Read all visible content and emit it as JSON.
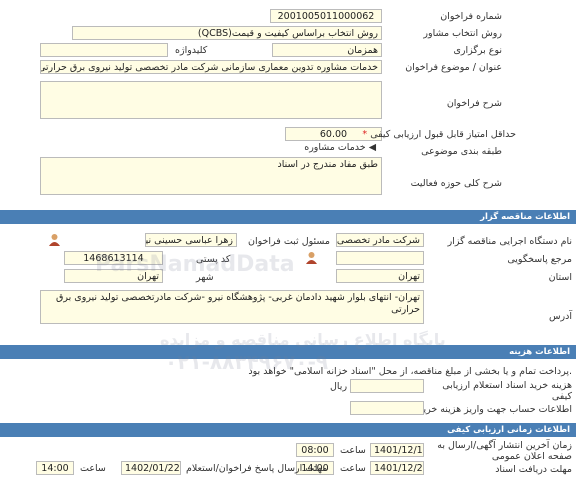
{
  "header": {
    "tender_number_label": "شماره فراخوان",
    "tender_number": "2001005011000062",
    "method_label": "روش انتخاب مشاور",
    "method": "روش انتخاب براساس کیفیت و قیمت(QCBS)",
    "type_label": "نوع برگزاری",
    "type": "همزمان",
    "keyword_label": "کلیدواژه",
    "keyword": "",
    "title_label": "عنوان / موضوع فراخوان",
    "title": "خدمات مشاوره تدوین معماری سازمانی  شرکت مادر تخصصی تولید نیروی برق حرارتی",
    "desc_label": "شرح فراخوان",
    "desc": "",
    "min_score_label": "حداقل امتیاز قابل قبول ارزیابی کیفی",
    "min_score": "60.00",
    "category_label": "طبقه بندی موضوعی",
    "category": "خدمات مشاوره",
    "scope_label": "شرح کلی حوزه فعالیت",
    "scope": "طبق مفاد مندرج در اسناد"
  },
  "organizer_section": {
    "title": "اطلاعات مناقصه گزار",
    "org_name_label": "نام دستگاه اجرایی مناقصه گزار",
    "org_name": "شرکت مادر تخصصی تولید نیروی برق",
    "registrar_label": "مسئول ثبت فراخوان",
    "registrar": "زهرا عباسی حسینی نیارکی",
    "reference_label": "مرجع پاسخگویی",
    "reference": "",
    "postal_label": "کد پستی",
    "postal": "1468613114",
    "province_label": "استان",
    "province": "تهران",
    "city_label": "شهر",
    "city": "تهران",
    "address_label": "آدرس",
    "address": "تهران- انتهای بلوار شهید دادمان غربی- پژوهشگاه نیرو -شرکت مادرتخصصی تولید نیروی برق حرارتی"
  },
  "fee_section": {
    "title": "اطلاعات هزینه",
    "note": "پرداخت تمام و یا بخشی از مبلغ مناقصه، از محل \"اسناد خزانه اسلامی\" خواهد بود.",
    "fee_label": "هزینه خرید اسناد استعلام ارزیابی کیفی",
    "fee": "",
    "currency": "ریال",
    "account_label": "اطلاعات حساب جهت واریز هزینه خرید",
    "account": ""
  },
  "dates_section": {
    "title": "اطلاعات زمانی ارزیابی کیفی",
    "publish_label": "زمان آخرین انتشار آگهی/ارسال به صفحه اعلان عمومی",
    "publish_date": "1401/12/16",
    "publish_time": "08:00",
    "time_label": "ساعت",
    "download_label": "مهلت دریافت اسناد",
    "download_date": "1401/12/28",
    "download_time": "14:00",
    "response_label": "مهلت ارسال پاسخ فراخوان/استعلام",
    "response_date": "1402/01/22",
    "response_time": "14:00"
  },
  "watermark": {
    "line1": "ParsNamadData",
    "line2": "پایگاه اطلاع رسانی مناقصه و مزایده",
    "phone": "۰۲۱-۸۸۳۴۹۶۷۰-۹"
  }
}
